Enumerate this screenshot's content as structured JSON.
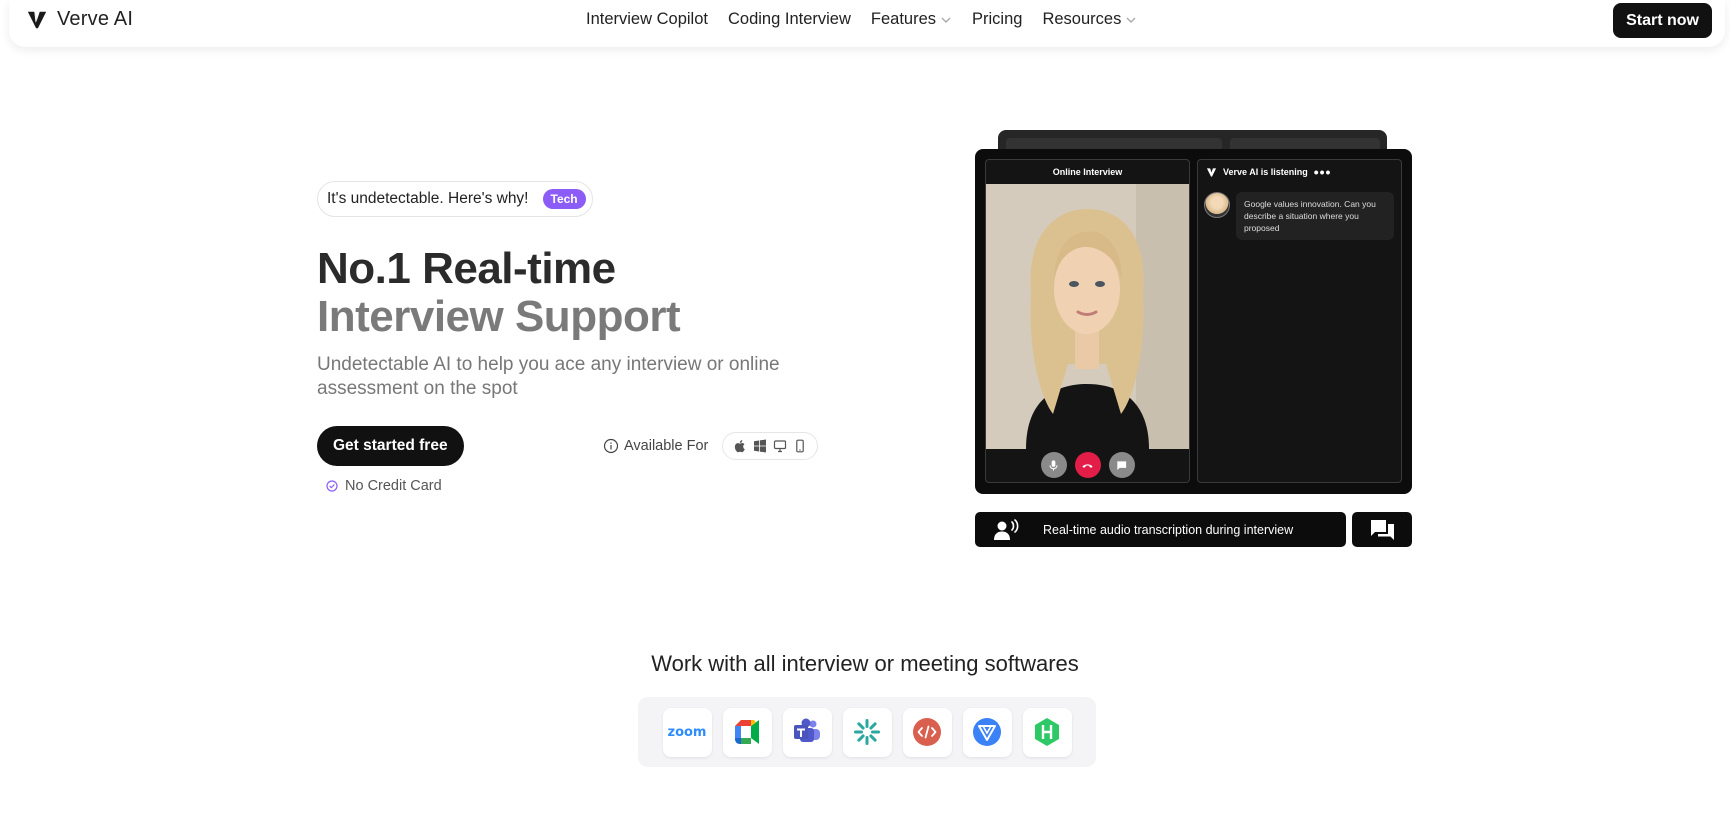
{
  "nav": {
    "brand": "Verve AI",
    "links": [
      {
        "label": "Interview Copilot",
        "dropdown": false
      },
      {
        "label": "Coding Interview",
        "dropdown": false
      },
      {
        "label": "Features",
        "dropdown": true
      },
      {
        "label": "Pricing",
        "dropdown": false
      },
      {
        "label": "Resources",
        "dropdown": true
      }
    ],
    "cta": "Start now"
  },
  "hero": {
    "pill_text": "It's undetectable. Here's why!",
    "pill_badge": "Tech",
    "title_line1": "No.1 Real-time",
    "title_line2": "Interview Support",
    "subtitle": "Undetectable AI to help you ace any interview or online assessment on the spot",
    "cta": "Get started free",
    "no_card": "No Credit Card",
    "available_label": "Available For",
    "platform_icons": [
      "apple-icon",
      "windows-icon",
      "desktop-icon",
      "mobile-icon"
    ]
  },
  "mockup": {
    "video_title": "Online Interview",
    "assistant_status": "Verve AI is listening",
    "assistant_dots": "•••",
    "message": "Google values innovation. Can you describe a situation where you proposed",
    "caption": "Real-time audio transcription during interview",
    "colors": {
      "end_call": "#e11d48",
      "control": "#8a8a8a"
    }
  },
  "integrations": {
    "title": "Work with all interview or meeting softwares",
    "apps": [
      {
        "name": "zoom",
        "label": "zoom"
      },
      {
        "name": "google-meet"
      },
      {
        "name": "microsoft-teams"
      },
      {
        "name": "webex"
      },
      {
        "name": "codility"
      },
      {
        "name": "codesignal"
      },
      {
        "name": "hackerrank"
      }
    ]
  },
  "colors": {
    "accent": "#8b5cf6",
    "dark": "#111111"
  }
}
